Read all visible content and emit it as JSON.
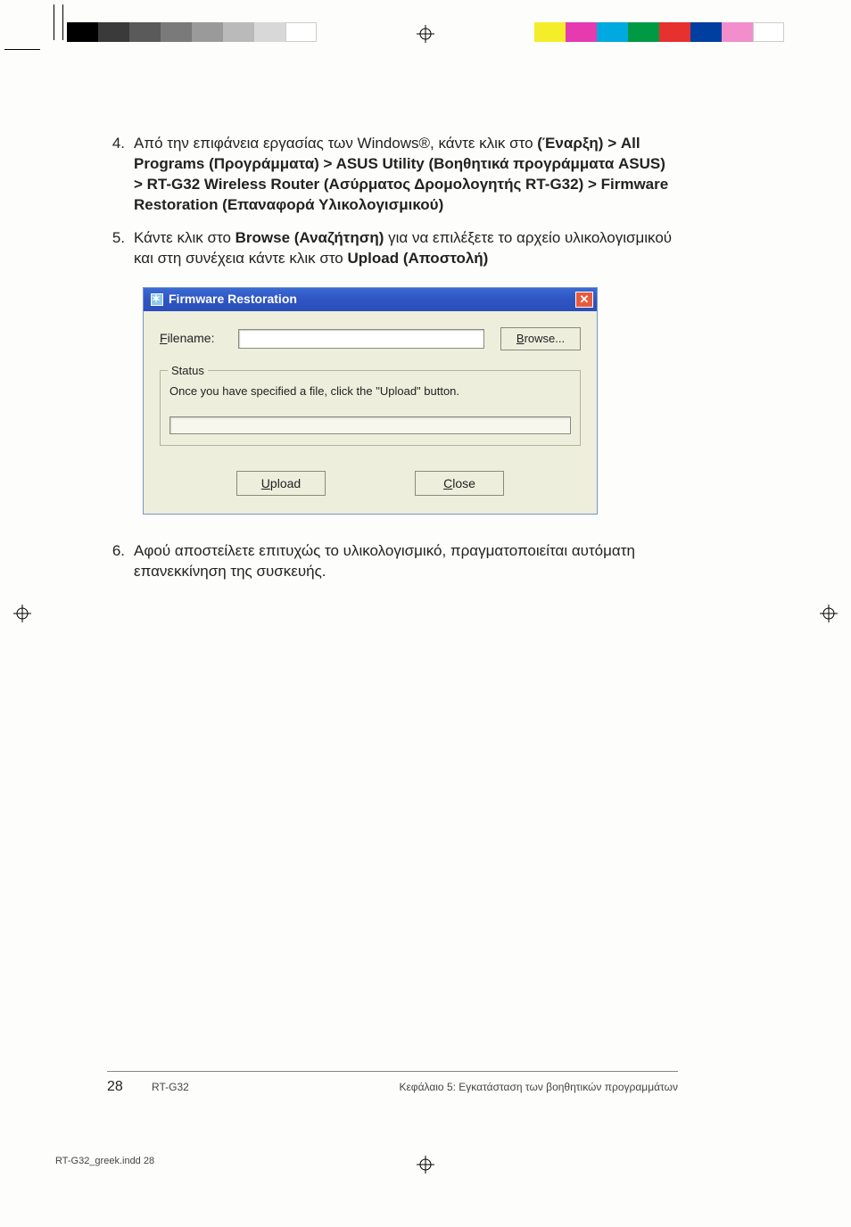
{
  "printer_marks": {
    "grayscale_bar": [
      "#000000",
      "#3a3a3a",
      "#5a5a5a",
      "#7a7a7a",
      "#9a9a9a",
      "#bababa",
      "#d8d8d8",
      "#ffffff"
    ],
    "color_bar": [
      "#f4ee2a",
      "#e63ab0",
      "#00a9df",
      "#009a44",
      "#e6312e",
      "#003ea0",
      "#f28ecb",
      "#ffffff"
    ]
  },
  "steps": {
    "s4": {
      "num": "4.",
      "plain1": "Από την επιφάνεια εργασίας των Windows®, κάντε κλικ στο ",
      "bold": "(Έναρξη) > All Programs (Προγράμματα) > ASUS Utility (Βοηθητικά προγράμματα ASUS) > RT-G32 Wireless Router (Ασύρματος Δρομολογητής RT-G32) > Firmware Restoration (Επαναφορά Υλικολογισμικού)"
    },
    "s5": {
      "num": "5.",
      "a": "Κάντε κλικ στο ",
      "b_bold": "Browse (Αναζήτηση)",
      "c": " για να επιλέξετε το αρχείο υλικολογισμικού και στη συνέχεια κάντε κλικ στο ",
      "d_bold": "Upload (Αποστολή)"
    },
    "s6": {
      "num": "6.",
      "text": "Αφού αποστείλετε επιτυχώς το υλικολογισμικό, πραγματοποιείται αυτόματη επανεκκίνηση της συσκευής."
    }
  },
  "dialog": {
    "title": "Firmware Restoration",
    "filename_label_pre": "F",
    "filename_label_post": "ilename:",
    "browse_pre": "B",
    "browse_post": "rowse...",
    "status_legend": "Status",
    "status_text": "Once you have specified a file, click the \"Upload\" button.",
    "upload_pre": "U",
    "upload_post": "pload",
    "close_pre": "C",
    "close_post": "lose",
    "close_x": "✕"
  },
  "footer": {
    "page": "28",
    "model": "RT-G32",
    "chapter": "Κεφάλαιο 5: Εγκατάσταση των βοηθητικών προγραμμάτων"
  },
  "slug": "RT-G32_greek.indd   28"
}
